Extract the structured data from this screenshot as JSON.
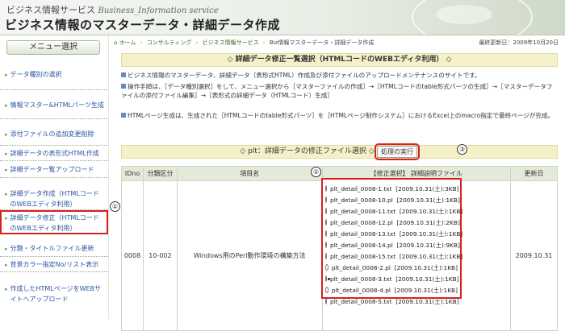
{
  "header": {
    "site_name_jp": "ビジネス情報サービス",
    "site_name_en": "Business_Information service",
    "title": "ビジネス情報のマスターデータ・詳細データ作成"
  },
  "sidebar": {
    "menu_label": "メニュー選択",
    "items": [
      {
        "label": "データ種別の選択"
      },
      {
        "label": "情報マスター&HTMLパーツ生成"
      },
      {
        "label": "添付ファイルの追加変更削除"
      },
      {
        "label": "詳細データの表形式HTML作成"
      },
      {
        "label": "詳細データ一覧アップロード"
      },
      {
        "label": "詳細データ作成（HTMLコードのWEBエディタ利用）"
      },
      {
        "label": "詳細データ修正（HTMLコードのWEBエディタ利用）"
      },
      {
        "label": "分類・タイトルファイル更新"
      },
      {
        "label": "背景カラー指定No/リスト表示"
      },
      {
        "label": "作成したHTMLページをWEBサイトへアップロード"
      }
    ]
  },
  "breadcrumb": {
    "items": [
      "ホーム",
      "コンサルティング",
      "ビジネス情報サービス",
      "Biz情報マスターデータ・詳細データ作成"
    ],
    "updated": "最終更新日：2009年10月20日"
  },
  "section1": {
    "title": "◇ 詳細データ修正一覧選択（HTMLコードのWEBエディタ利用） ◇",
    "para1": "ビジネス情報のマスターデータ、詳細データ（表形式HTML）作成及び添付ファイルのアップロードメンテナンスのサイトです。",
    "para2": "操作手順は、［データ種別選択］をして、メニュー選択から［マスターファイルの作成］→［HTMLコードのtable形式パーツの生成］→［マスターデータファイルの添付ファイル編集］→［表形式の詳細データ（HTMLコード）生成］",
    "para3": "HTMLページ生成は、生成された［HTMLコードのtable形式パーツ］を［HTMLページ制作システム］におけるExcel上のmacro指定で最終ページが完成。"
  },
  "section2": {
    "title": "◇ plt：詳細データの修正ファイル選択 ◇",
    "exec_button": "処理の実行"
  },
  "table": {
    "headers": [
      "IDno",
      "分類区分",
      "項目名",
      "【修正選択】 詳細説明ファイル",
      "更新日"
    ],
    "row": {
      "id": "0008",
      "category": "10-002",
      "item": "Windows用のPerl動作環境の構築方法",
      "updated": "2009.10.31"
    },
    "files": [
      {
        "name": "plt_detail_0008-1.txt",
        "info": "[2009.10.31(土):3KB]",
        "selected": false
      },
      {
        "name": "plt_detail_0008-10.pl",
        "info": "[2009.10.31(土):1KB]",
        "selected": false
      },
      {
        "name": "plt_detail_0008-11.txt",
        "info": "[2009.10.31(土):1KB]",
        "selected": false
      },
      {
        "name": "plt_detail_0008-12.pl",
        "info": "[2009.10.31(土):2KB]",
        "selected": false
      },
      {
        "name": "plt_detail_0008-13.txt",
        "info": "[2009.10.31(土):1KB]",
        "selected": false
      },
      {
        "name": "plt_detail_0008-14.pl",
        "info": "[2009.10.31(土):9KB]",
        "selected": false
      },
      {
        "name": "plt_detail_0008-15.txt",
        "info": "[2009.10.31(土):1KB]",
        "selected": false
      },
      {
        "name": "plt_detail_0008-2.pl",
        "info": "[2009.10.31(土):1KB]",
        "selected": false
      },
      {
        "name": "plt_detail_0008-3.txt",
        "info": "[2009.10.31(土):1KB]",
        "selected": true
      },
      {
        "name": "plt_detail_0008-4.pl",
        "info": "[2009.10.31(土):1KB]",
        "selected": false
      },
      {
        "name": "plt_detail_0008-5.txt",
        "info": "[2009.10.31(土):1KB]",
        "selected": false
      }
    ]
  },
  "markers": [
    "①",
    "②",
    "③"
  ],
  "colors": {
    "highlight": "#d8201f",
    "section_bg": "#f4f1c8",
    "table_header_bg": "#e4ead8",
    "link": "#2a55a0"
  }
}
